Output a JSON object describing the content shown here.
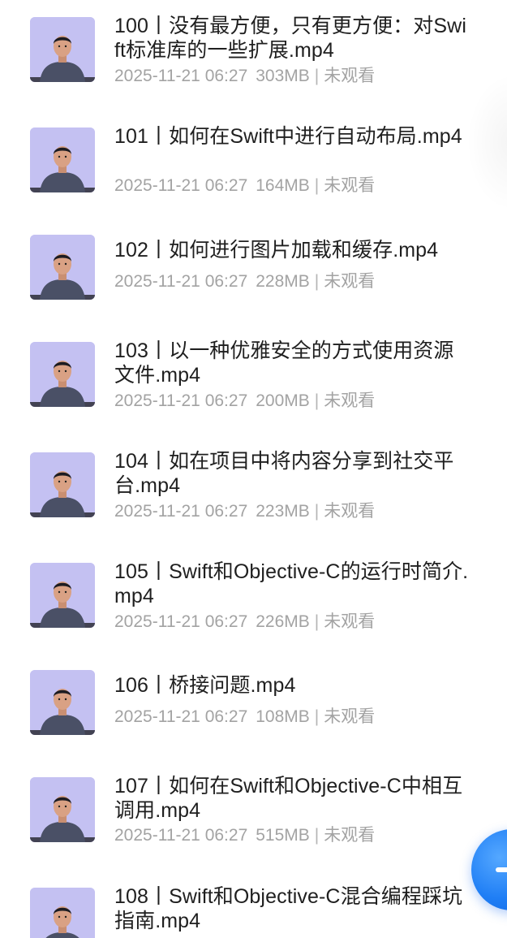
{
  "items": [
    {
      "title": "100丨没有最方便，只有更方便：对Swift标准库的一些扩展.mp4",
      "date": "2025-11-21 06:27",
      "size": "303MB",
      "status": "未观看"
    },
    {
      "title": "101丨如何在Swift中进行自动布局.mp4",
      "date": "2025-11-21 06:27",
      "size": "164MB",
      "status": "未观看"
    },
    {
      "title": "102丨如何进行图片加载和缓存.mp4",
      "date": "2025-11-21 06:27",
      "size": "228MB",
      "status": "未观看"
    },
    {
      "title": "103丨以一种优雅安全的方式使用资源文件.mp4",
      "date": "2025-11-21 06:27",
      "size": "200MB",
      "status": "未观看"
    },
    {
      "title": "104丨如在项目中将内容分享到社交平台.mp4",
      "date": "2025-11-21 06:27",
      "size": "223MB",
      "status": "未观看"
    },
    {
      "title": "105丨Swift和Objective-C的运行时简介.mp4",
      "date": "2025-11-21 06:27",
      "size": "226MB",
      "status": "未观看"
    },
    {
      "title": "106丨桥接问题.mp4",
      "date": "2025-11-21 06:27",
      "size": "108MB",
      "status": "未观看"
    },
    {
      "title": "107丨如何在Swift和Objective-C中相互调用.mp4",
      "date": "2025-11-21 06:27",
      "size": "515MB",
      "status": "未观看"
    },
    {
      "title": "108丨Swift和Objective-C混合编程踩坑指南.mp4",
      "date": "",
      "size": "",
      "status": ""
    }
  ],
  "fab": {
    "icon": "add-icon"
  }
}
